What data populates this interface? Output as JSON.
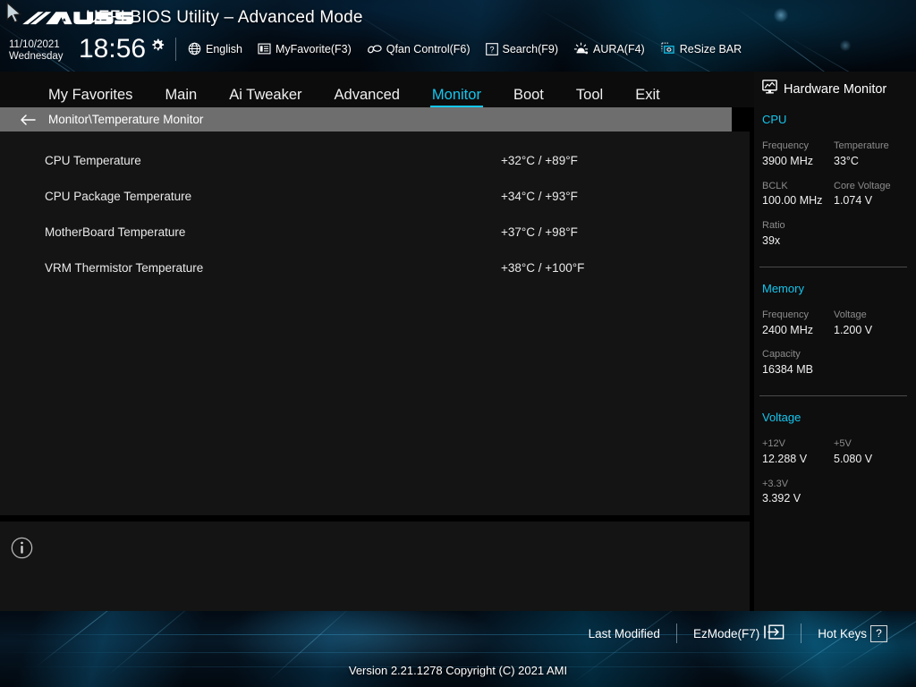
{
  "header": {
    "title": "UEFI BIOS Utility – Advanced Mode",
    "brand": "ASUS",
    "date": "11/10/2021",
    "weekday": "Wednesday",
    "time": "18:56",
    "gear_icon": "gear-icon",
    "cursor_icon": "mouse-cursor",
    "toolbar": [
      {
        "label": "English",
        "icon": "globe-icon"
      },
      {
        "label": "MyFavorite(F3)",
        "icon": "list-icon"
      },
      {
        "label": "Qfan Control(F6)",
        "icon": "fan-icon"
      },
      {
        "label": "Search(F9)",
        "icon": "question-box-icon"
      },
      {
        "label": "AURA(F4)",
        "icon": "aura-light-icon"
      },
      {
        "label": "ReSize BAR",
        "icon": "resize-bar-icon"
      }
    ]
  },
  "tabs": [
    {
      "label": "My Favorites",
      "active": false
    },
    {
      "label": "Main",
      "active": false
    },
    {
      "label": "Ai Tweaker",
      "active": false
    },
    {
      "label": "Advanced",
      "active": false
    },
    {
      "label": "Monitor",
      "active": true
    },
    {
      "label": "Boot",
      "active": false
    },
    {
      "label": "Tool",
      "active": false
    },
    {
      "label": "Exit",
      "active": false
    }
  ],
  "breadcrumb": {
    "back_icon": "back-arrow-icon",
    "path": "Monitor\\Temperature Monitor"
  },
  "main": {
    "items": [
      {
        "name": "CPU Temperature",
        "value": "+32°C / +89°F"
      },
      {
        "name": "CPU Package Temperature",
        "value": "+34°C / +93°F"
      },
      {
        "name": "MotherBoard Temperature",
        "value": "+37°C / +98°F"
      },
      {
        "name": "VRM Thermistor Temperature",
        "value": "+38°C / +100°F"
      }
    ],
    "help_icon": "info-icon",
    "help_text": ""
  },
  "sidebar": {
    "title": "Hardware Monitor",
    "title_icon": "monitor-chart-icon",
    "sections": [
      {
        "name": "CPU",
        "fields": [
          {
            "key": "Frequency",
            "value": "3900 MHz"
          },
          {
            "key": "Temperature",
            "value": "33°C"
          },
          {
            "key": "BCLK",
            "value": "100.00 MHz"
          },
          {
            "key": "Core Voltage",
            "value": "1.074 V"
          },
          {
            "key": "Ratio",
            "value": "39x"
          },
          {
            "key": "",
            "value": ""
          }
        ]
      },
      {
        "name": "Memory",
        "fields": [
          {
            "key": "Frequency",
            "value": "2400 MHz"
          },
          {
            "key": "Voltage",
            "value": "1.200 V"
          },
          {
            "key": "Capacity",
            "value": "16384 MB"
          },
          {
            "key": "",
            "value": ""
          }
        ]
      },
      {
        "name": "Voltage",
        "fields": [
          {
            "key": "+12V",
            "value": "12.288 V"
          },
          {
            "key": "+5V",
            "value": "5.080 V"
          },
          {
            "key": "+3.3V",
            "value": "3.392 V"
          },
          {
            "key": "",
            "value": ""
          }
        ]
      }
    ]
  },
  "footer": {
    "last_modified": "Last Modified",
    "ezmode": "EzMode(F7)",
    "ezmode_icon": "exit-arrow-icon",
    "hotkeys": "Hot Keys",
    "hotkeys_icon": "question-box-icon",
    "version": "Version 2.21.1278 Copyright (C) 2021 AMI"
  },
  "colors": {
    "accent_cyan": "#13c6ef",
    "panel_bg": "#141414",
    "sidebar_bg": "#0e0e0e",
    "tabbar_bg": "#0c0c0c",
    "breadcrumb_bg": "#6e6e6e",
    "text": "#e9e9e9",
    "muted": "#8c8c8c"
  }
}
